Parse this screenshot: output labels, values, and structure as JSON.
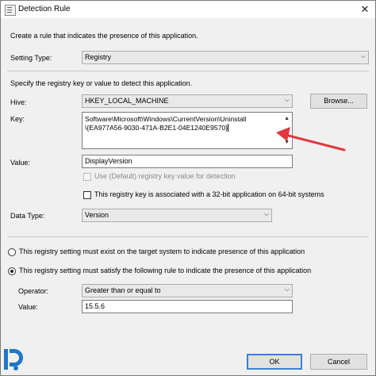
{
  "window": {
    "title": "Detection Rule",
    "close_glyph": "✕"
  },
  "intro": "Create a rule that indicates the presence of this application.",
  "setting_type": {
    "label": "Setting Type:",
    "value": "Registry"
  },
  "specify_text": "Specify the registry key or value to detect this application.",
  "hive": {
    "label": "Hive:",
    "value": "HKEY_LOCAL_MACHINE",
    "browse_label": "Browse..."
  },
  "key": {
    "label": "Key:",
    "line1": "Software\\Microsoft\\Windows\\CurrentVersion\\Uninstall",
    "line2": "\\{EA977A56-9030-471A-B2E1-04E1240E9570}"
  },
  "value_field": {
    "label": "Value:",
    "value": "DisplayVersion"
  },
  "use_default_label": "Use (Default) registry key value for detection",
  "registry_32bit_label": "This registry key is associated with a 32-bit application on 64-bit systems",
  "data_type": {
    "label": "Data Type:",
    "value": "Version"
  },
  "radio_exist_label": "This registry setting must exist on the target system to indicate presence of this application",
  "radio_satisfy_label": "This registry setting must satisfy the following rule to indicate the presence of this application",
  "operator": {
    "label": "Operator:",
    "value": "Greater than or equal to"
  },
  "rule_value": {
    "label": "Value:",
    "value": "15.5.6"
  },
  "buttons": {
    "ok": "OK",
    "cancel": "Cancel"
  },
  "colors": {
    "arrow": "#e2383f",
    "logo": "#1f77c4",
    "focus": "#3c7fd4"
  }
}
